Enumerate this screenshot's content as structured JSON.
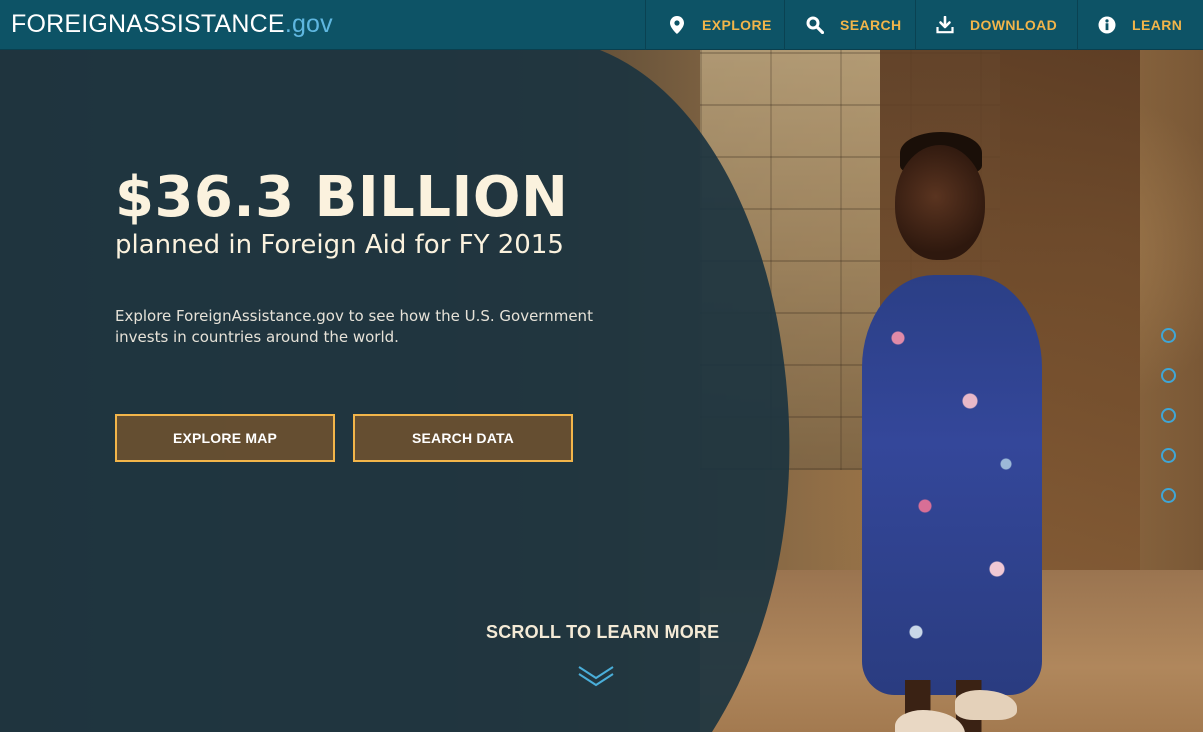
{
  "header": {
    "logo_main": "FOREIGNASSISTANCE",
    "logo_tld": ".gov",
    "nav": {
      "explore": "EXPLORE",
      "search": "SEARCH",
      "download": "DOWNLOAD",
      "learn": "LEARN"
    }
  },
  "hero": {
    "headline": "$36.3 BILLION",
    "subhead": "planned in Foreign Aid for FY 2015",
    "description": "Explore ForeignAssistance.gov to see how the U.S. Government invests in countries around the world.",
    "buttons": {
      "explore_map": "EXPLORE MAP",
      "search_data": "SEARCH DATA"
    },
    "scroll_label": "SCROLL TO LEARN MORE",
    "pager_count": 5
  },
  "colors": {
    "header_bg": "#0d5366",
    "accent": "#f2b54a",
    "overlay": "#1c3440",
    "pager": "#3fa6d6",
    "text_cream": "#fbf2de"
  },
  "icons": {
    "explore": "map-pin-icon",
    "search": "search-icon",
    "download": "download-icon",
    "learn": "info-icon",
    "scroll": "chevron-down-double-icon"
  }
}
